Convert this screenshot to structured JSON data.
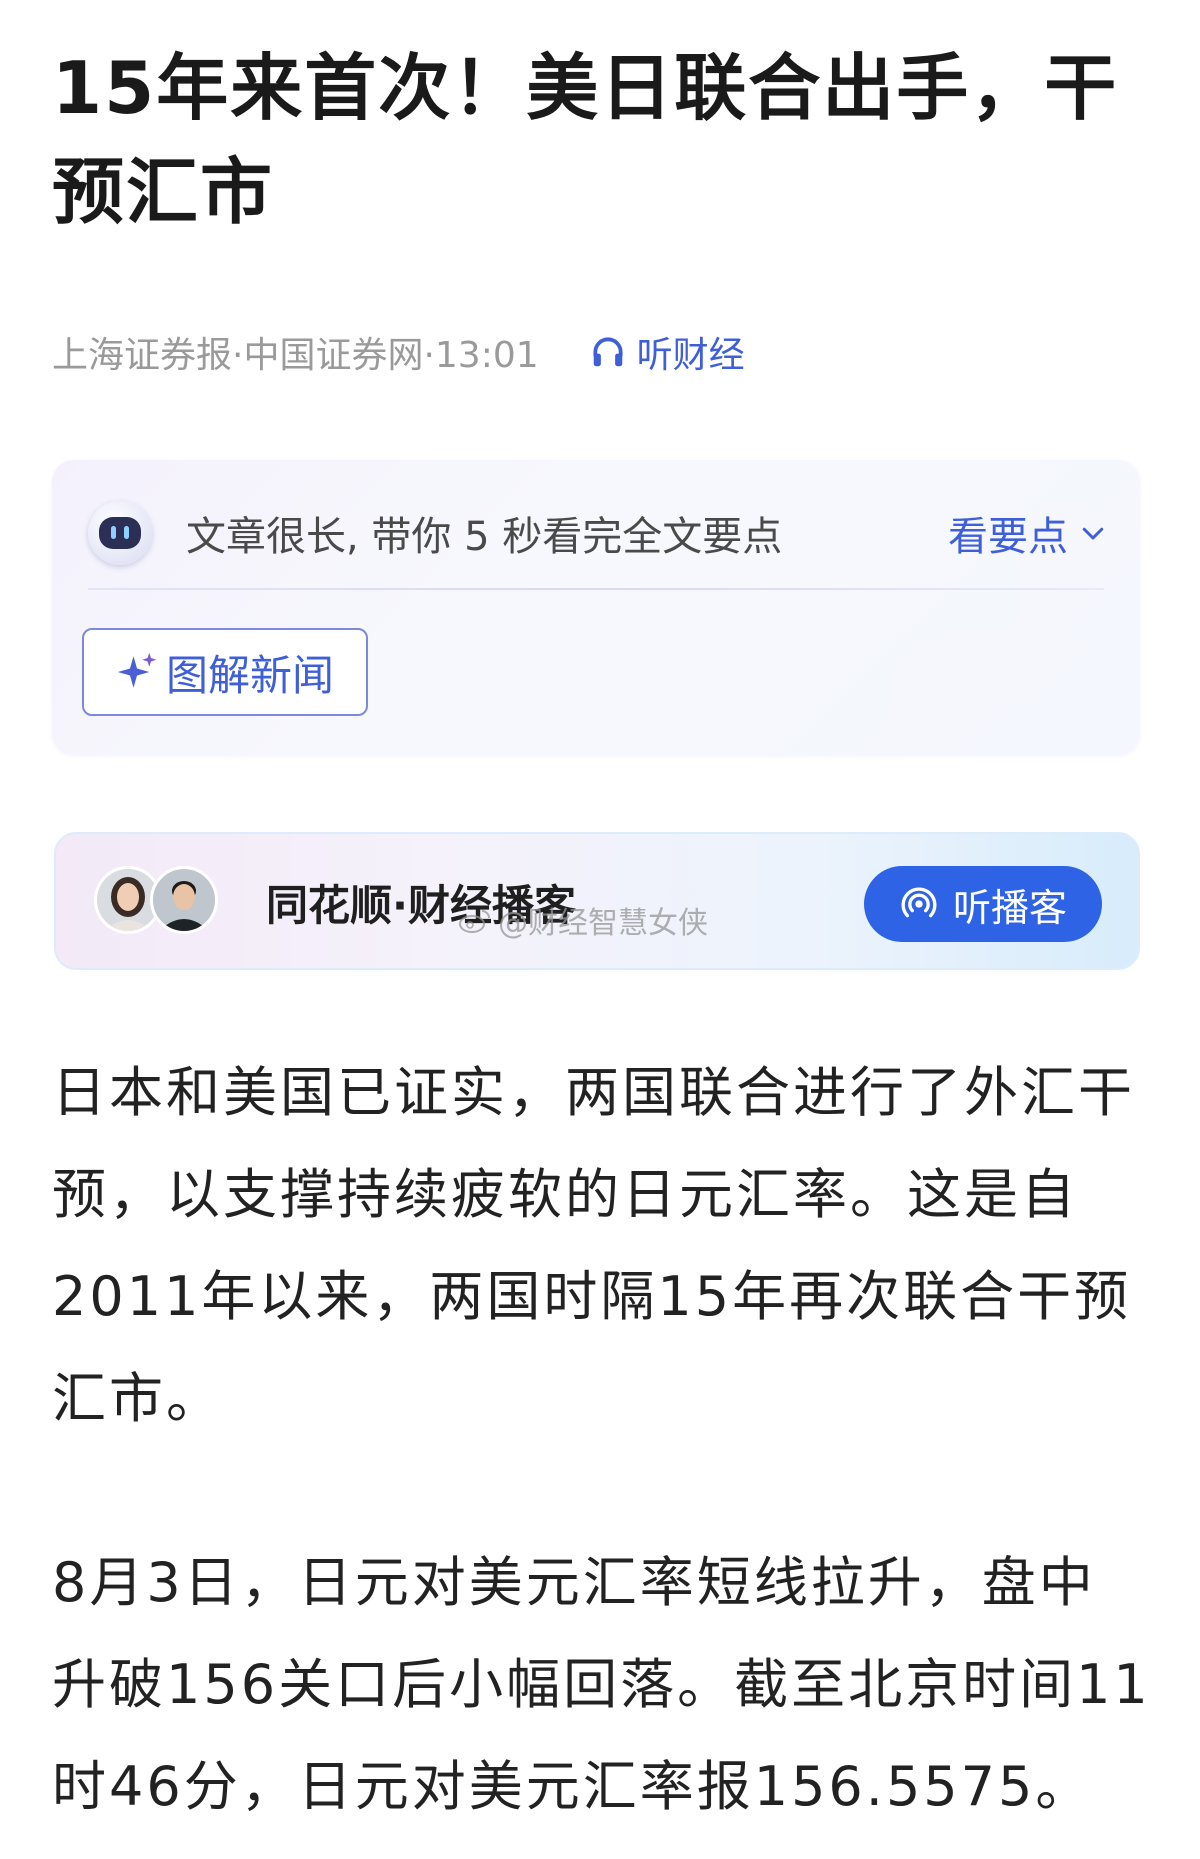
{
  "article": {
    "title": "15年来首次！美日联合出手，干预汇市",
    "source": "上海证券报·中国证券网·13:01",
    "listen_label": "听财经"
  },
  "summary": {
    "text": "文章很长, 带你 5 秒看完全文要点",
    "key_points_label": "看要点",
    "illustrated_news_label": "图解新闻"
  },
  "podcast": {
    "title": "同花顺·财经播客",
    "button_label": "听播客"
  },
  "watermark": "@财经智慧女侠",
  "paragraphs": [
    "日本和美国已证实，两国联合进行了外汇干预，以支撑持续疲软的日元汇率。这是自2011年以来，两国时隔15年再次联合干预汇市。",
    "8月3日，日元对美元汇率短线拉升，盘中升破156关口后小幅回落。截至北京时间11时46分，日元对美元汇率报156.5575。"
  ],
  "colors": {
    "accent": "#3f5fd8",
    "button_blue": "#2f63e6",
    "meta_gray": "#9a9a9a"
  },
  "icons": {
    "listen": "headphones-icon",
    "robot": "robot-icon",
    "chevron": "chevron-down-icon",
    "sparkle": "sparkle-icon",
    "podcast": "broadcast-icon",
    "weibo": "weibo-icon"
  }
}
